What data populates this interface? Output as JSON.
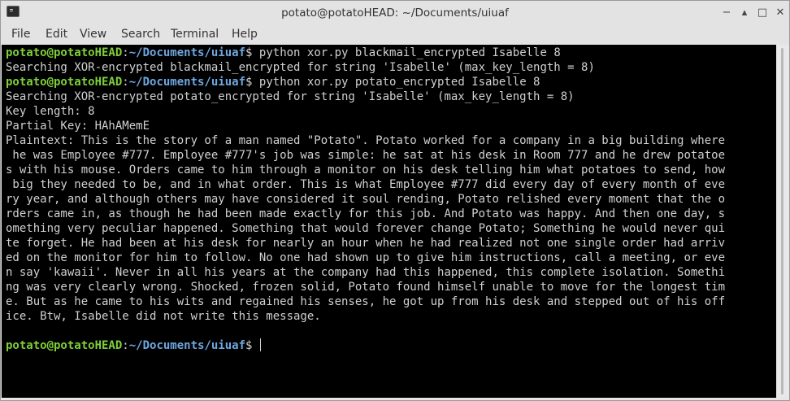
{
  "window": {
    "title": "potato@potatoHEAD: ~/Documents/uiuaf",
    "controls": {
      "min": "−",
      "up": "▴",
      "max": "□",
      "close": "✕"
    }
  },
  "menu": [
    "File",
    "Edit",
    "View",
    "Search",
    "Terminal",
    "Help"
  ],
  "prompt": {
    "user": "potato@potatoHEAD",
    "sep": ":",
    "path": "~/Documents/uiuaf",
    "symbol": "$"
  },
  "commands": [
    "python xor.py blackmail_encrypted Isabelle 8",
    "python xor.py potato_encrypted Isabelle 8"
  ],
  "output1": "Searching XOR-encrypted blackmail_encrypted for string 'Isabelle' (max_key_length = 8)",
  "output2": [
    "Searching XOR-encrypted potato_encrypted for string 'Isabelle' (max_key_length = 8)",
    "Key length: 8",
    "Partial Key: HAhAMemE",
    "Plaintext: This is the story of a man named \"Potato\". Potato worked for a company in a big building where",
    " he was Employee #777. Employee #777's job was simple: he sat at his desk in Room 777 and he drew potatoe",
    "s with his mouse. Orders came to him through a monitor on his desk telling him what potatoes to send, how",
    " big they needed to be, and in what order. This is what Employee #777 did every day of every month of eve",
    "ry year, and although others may have considered it soul rending, Potato relished every moment that the o",
    "rders came in, as though he had been made exactly for this job. And Potato was happy. And then one day, s",
    "omething very peculiar happened. Something that would forever change Potato; Something he would never qui",
    "te forget. He had been at his desk for nearly an hour when he had realized not one single order had arriv",
    "ed on the monitor for him to follow. No one had shown up to give him instructions, call a meeting, or eve",
    "n say 'kawaii'. Never in all his years at the company had this happened, this complete isolation. Somethi",
    "ng was very clearly wrong. Shocked, frozen solid, Potato found himself unable to move for the longest tim",
    "e. But as he came to his wits and regained his senses, he got up from his desk and stepped out of his off",
    "ice. Btw, Isabelle did not write this message."
  ]
}
